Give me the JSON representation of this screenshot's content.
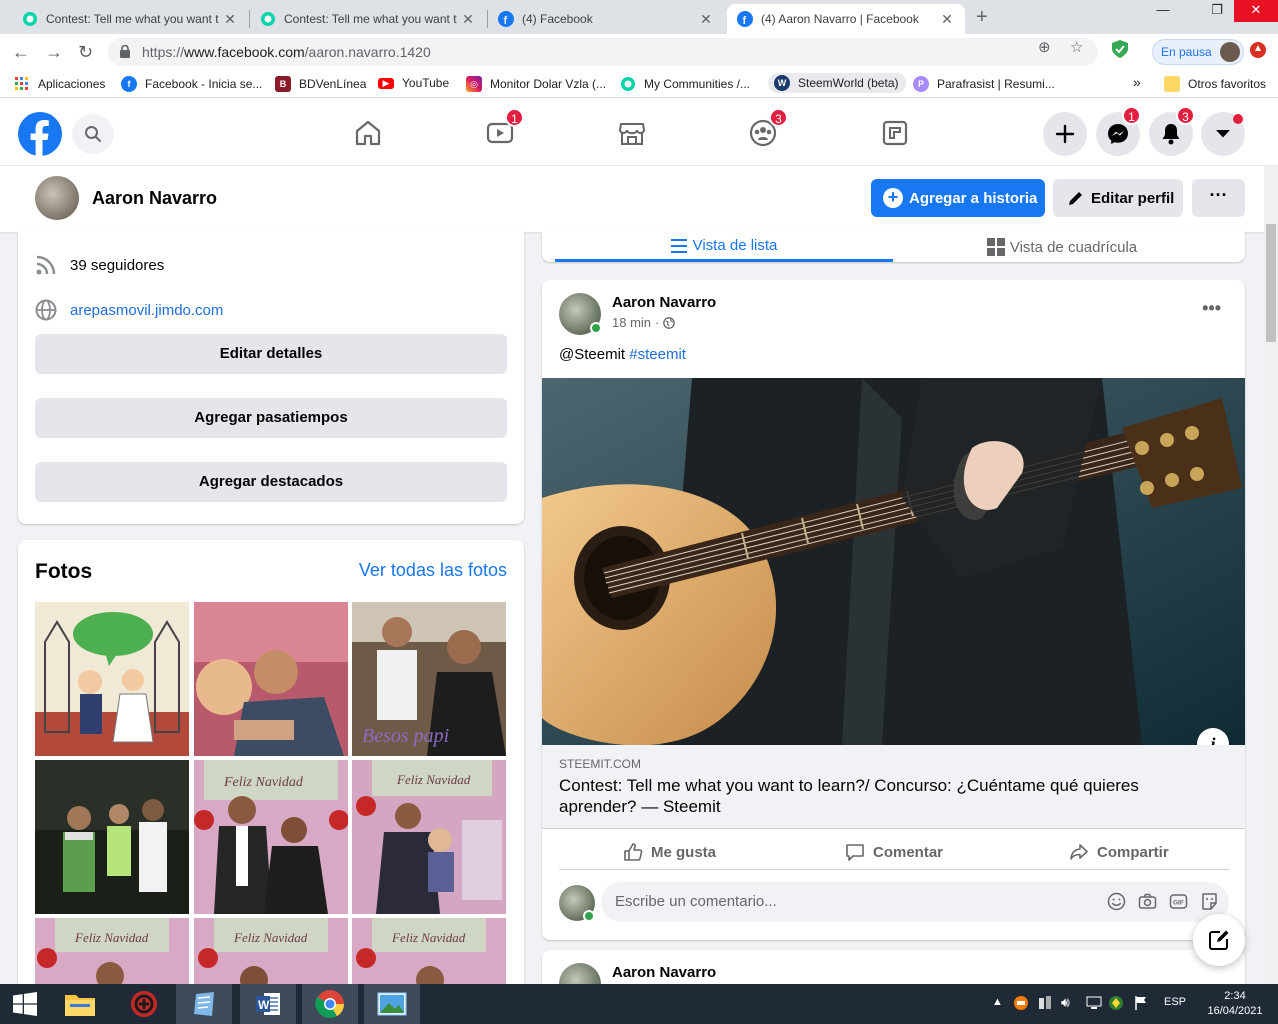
{
  "browser": {
    "tabs": [
      {
        "title": "Contest: Tell me what you want t",
        "favicon": "steemit-icon"
      },
      {
        "title": "Contest: Tell me what you want t",
        "favicon": "steemit-icon"
      },
      {
        "title": "(4) Facebook",
        "favicon": "facebook-icon"
      },
      {
        "title": "(4) Aaron Navarro | Facebook",
        "favicon": "facebook-icon",
        "active": true
      }
    ],
    "url_scheme": "https://",
    "url_host": "www.facebook.com",
    "url_path": "/aaron.navarro.1420",
    "paused_label": "En pausa",
    "bookmarks": [
      {
        "label": "Aplicaciones"
      },
      {
        "label": "Facebook - Inicia se..."
      },
      {
        "label": "BDVenLínea"
      },
      {
        "label": "YouTube"
      },
      {
        "label": "Monitor Dolar Vzla (..."
      },
      {
        "label": "My Communities /..."
      },
      {
        "label": "SteemWorld (beta)"
      },
      {
        "label": "Parafrasist | Resumi..."
      }
    ],
    "bookmarks_overflow": "»",
    "other_bookmarks": "Otros favoritos"
  },
  "header": {
    "watch_badge": "1",
    "groups_badge": "3",
    "messenger_badge": "1",
    "notifications_badge": "3"
  },
  "profile": {
    "name": "Aaron Navarro",
    "add_story_label": "Agregar a historia",
    "edit_profile_label": "Editar perfil",
    "more_label": "···"
  },
  "intro": {
    "followers": "39 seguidores",
    "website": "arepasmovil.jimdo.com",
    "buttons": [
      "Editar detalles",
      "Agregar pasatiempos",
      "Agregar destacados"
    ]
  },
  "photos": {
    "heading": "Fotos",
    "see_all": "Ver todas las fotos"
  },
  "view_tabs": {
    "list": "Vista de lista",
    "grid": "Vista de cuadrícula"
  },
  "post": {
    "author": "Aaron Navarro",
    "time": "18 min",
    "time_sep": "·",
    "text_mention": "@Steemit",
    "text_hashtag": "#steemit",
    "link_domain": "STEEMIT.COM",
    "link_title": "Contest: Tell me what you want to learn?/ Concurso: ¿Cuéntame qué quieres aprender? — Steemit",
    "like_label": "Me gusta",
    "comment_label": "Comentar",
    "share_label": "Compartir",
    "comment_placeholder": "Escribe un comentario..."
  },
  "post2": {
    "author": "Aaron Navarro"
  },
  "taskbar": {
    "lang": "ESP",
    "time": "2:34",
    "date": "16/04/2021"
  },
  "colors": {
    "facebook_blue": "#1877f2",
    "badge_red": "#e41e3f",
    "online_green": "#31a24c"
  }
}
